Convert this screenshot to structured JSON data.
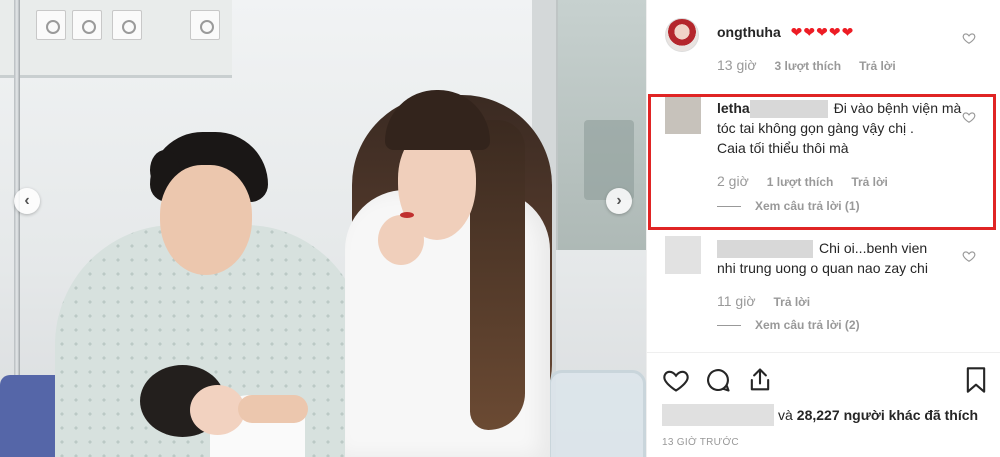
{
  "post": {
    "nav": {
      "prev_glyph": "‹",
      "next_glyph": "›"
    },
    "comments": [
      {
        "username": "ongthuha",
        "text": "❤❤❤❤❤",
        "time": "13 giờ",
        "likes": "3 lượt thích",
        "reply": "Trả lời",
        "avatar_icon": "profile-avatar"
      },
      {
        "username": "letha",
        "text": "Đi vào bệnh viện mà tóc tai không gọn gàng vậy chị . Caia tối thiểu thôi mà",
        "line1": "Đi vào bệnh viện mà",
        "line2": "tóc tai không gọn gàng vậy chị .",
        "line3": "Caia tối thiểu thôi mà",
        "time": "2 giờ",
        "likes": "1 lượt thích",
        "reply": "Trả lời",
        "view_replies": "Xem câu trả lời (1)",
        "highlighted": true
      },
      {
        "username": "",
        "text": "Chi oi...benh vien nhi trung uong o quan nao zay chi",
        "line1": "Chi oi...benh vien",
        "line2": "nhi trung uong o quan nao zay chi",
        "time": "11 giờ",
        "reply": "Trả lời",
        "view_replies": "Xem câu trả lời (2)"
      }
    ],
    "actions": {
      "like_icon": "heart-outline-icon",
      "comment_icon": "comment-bubble-icon",
      "share_icon": "share-upload-icon",
      "save_icon": "bookmark-icon"
    },
    "likes_summary": {
      "and_text": "và",
      "count": "28,227",
      "rest": "người khác đã thích"
    },
    "posted_ago": "13 GIỜ TRƯỚC"
  },
  "colors": {
    "highlight_border": "#e02424",
    "heart_red": "#ed1c24",
    "meta_gray": "#999999",
    "text_dark": "#262626"
  }
}
